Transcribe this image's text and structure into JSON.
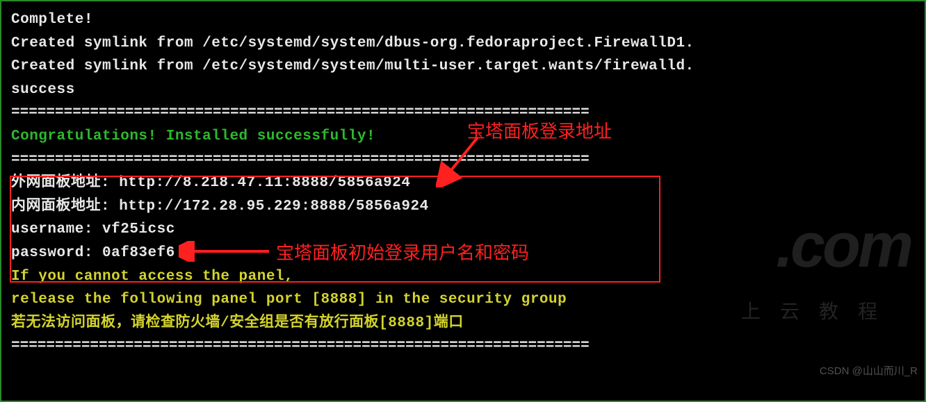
{
  "terminal": {
    "complete": "Complete!",
    "symlink1": "Created symlink from /etc/systemd/system/dbus-org.fedoraproject.FirewallD1.",
    "symlink2": "Created symlink from /etc/systemd/system/multi-user.target.wants/firewalld.",
    "success": "success",
    "separator": "==================================================================",
    "congrats": "Congratulations! Installed successfully!",
    "external_panel": "外网面板地址: http://8.218.47.11:8888/5856a924",
    "internal_panel": "内网面板地址: http://172.28.95.229:8888/5856a924",
    "username": "username: vf25icsc",
    "password": "password: 0af83ef6",
    "warning1": "If you cannot access the panel,",
    "warning2": "release the following panel port [8888] in the security group",
    "warning3": "若无法访问面板，请检查防火墙/安全组是否有放行面板[8888]端口"
  },
  "annotations": {
    "login_url": "宝塔面板登录地址",
    "credentials": "宝塔面板初始登录用户名和密码"
  },
  "watermarks": {
    "brand": ".com",
    "tagline": "上云教程",
    "attribution": "CSDN @山山而川_R"
  }
}
